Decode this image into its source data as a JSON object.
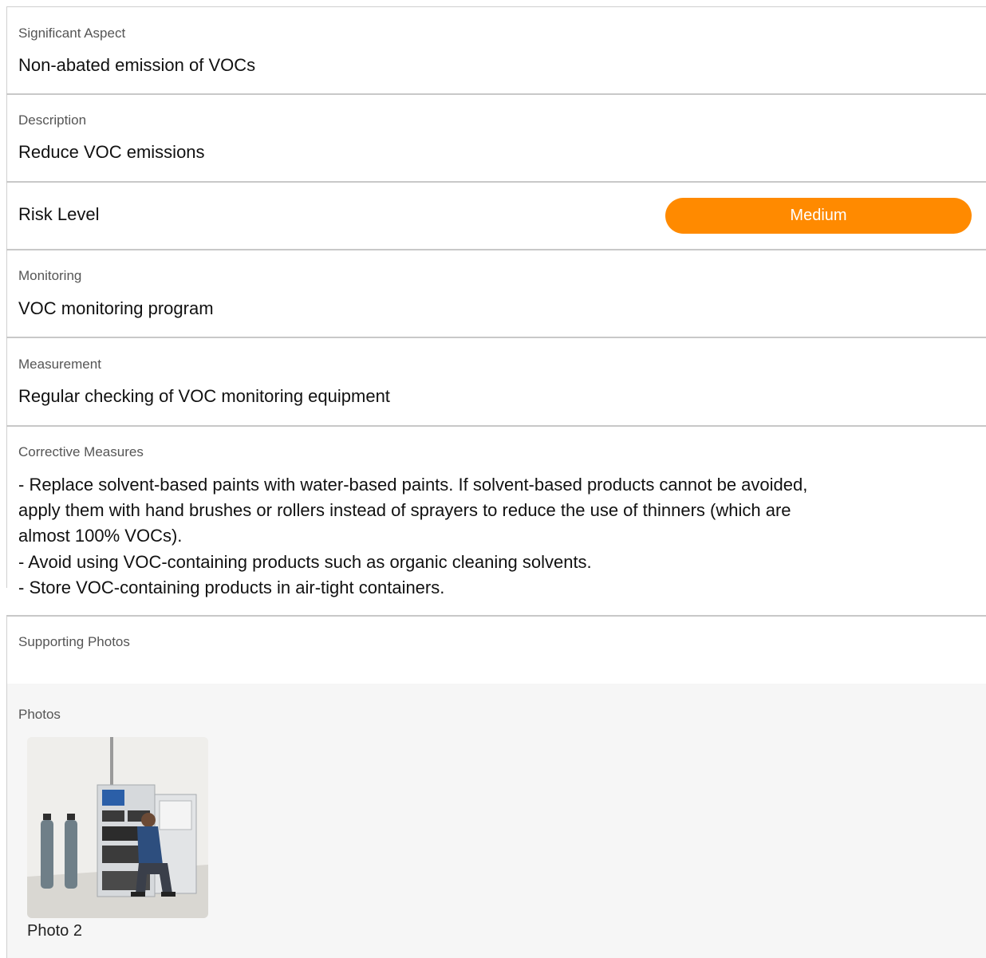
{
  "sections": {
    "significant_aspect": {
      "label": "Significant Aspect",
      "value": "Non-abated emission of VOCs"
    },
    "description": {
      "label": "Description",
      "value": "Reduce VOC emissions"
    },
    "risk_level": {
      "label": "Risk Level",
      "value": "Medium",
      "color": "#ff8a00"
    },
    "monitoring": {
      "label": "Monitoring",
      "value": "VOC monitoring program"
    },
    "measurement": {
      "label": "Measurement",
      "value": "Regular checking of VOC monitoring equipment"
    },
    "corrective_measures": {
      "label": "Corrective Measures",
      "lines": [
        "- Replace solvent-based paints with water-based paints. If solvent-based products cannot be avoided,",
        "apply them with hand brushes or rollers instead of sprayers to reduce the use of thinners (which are",
        "almost 100% VOCs).",
        "- Avoid using VOC-containing products such as organic cleaning solvents.",
        "- Store VOC-containing products in air-tight containers."
      ]
    },
    "supporting_photos": {
      "label": "Supporting Photos"
    },
    "photos": {
      "label": "Photos",
      "items": [
        {
          "caption": "Photo 2",
          "icon": "photo-icon"
        }
      ]
    }
  }
}
